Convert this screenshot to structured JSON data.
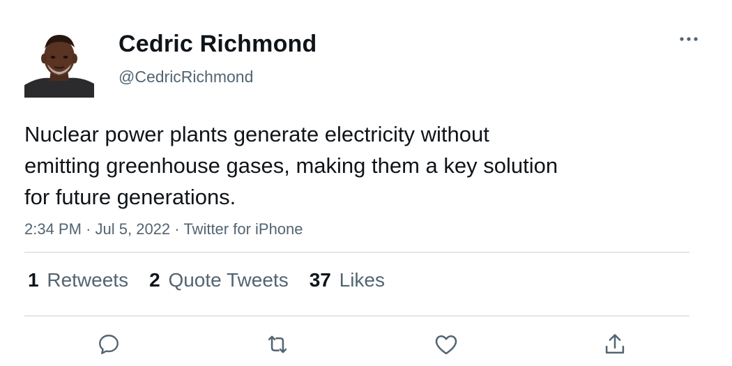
{
  "user": {
    "display_name": "Cedric Richmond",
    "handle": "@CedricRichmond"
  },
  "tweet": {
    "text": "Nuclear power plants generate electricity without\nemitting greenhouse gases, making them a key solution\nfor future generations.",
    "time": "2:34 PM",
    "separator": "·",
    "date": "Jul 5, 2022",
    "source": "Twitter for iPhone"
  },
  "stats": {
    "retweets": {
      "count": "1",
      "label": "Retweets"
    },
    "quote_tweets": {
      "count": "2",
      "label": "Quote Tweets"
    },
    "likes": {
      "count": "37",
      "label": "Likes"
    }
  },
  "icons": {
    "more": "more-horizontal-icon",
    "reply": "reply-icon",
    "retweet": "retweet-icon",
    "like": "heart-icon",
    "share": "share-icon"
  },
  "colors": {
    "text_primary": "#0f1419",
    "text_secondary": "#536471",
    "divider": "#e1e6ea"
  }
}
